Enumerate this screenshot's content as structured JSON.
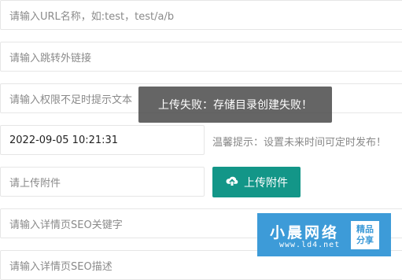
{
  "form": {
    "url_name": {
      "placeholder": "请输入URL名称，如:test，test/a/b"
    },
    "redirect_link": {
      "placeholder": "请输入跳转外链接"
    },
    "permission_text": {
      "placeholder": "请输入权限不足时提示文本"
    },
    "publish_time": {
      "value": "2022-09-05 10:21:31",
      "hint": "温馨提示：设置未来时间可定时发布！"
    },
    "attachment": {
      "placeholder": "请上传附件",
      "button_label": "上传附件",
      "button_icon": "cloud-upload-icon"
    },
    "seo_keywords": {
      "placeholder": "请输入详情页SEO关键字"
    },
    "seo_description": {
      "placeholder": "请输入详情页SEO描述"
    }
  },
  "toast": {
    "message": "上传失败：存储目录创建失败！"
  },
  "watermark": {
    "title": "小晨网络",
    "url": "www.ld4.net",
    "badge_line1": "精品",
    "badge_line2": "分享"
  },
  "colors": {
    "primary_button": "#139688",
    "toast_bg": "#505050",
    "watermark_bg": "#3d9bd8"
  }
}
